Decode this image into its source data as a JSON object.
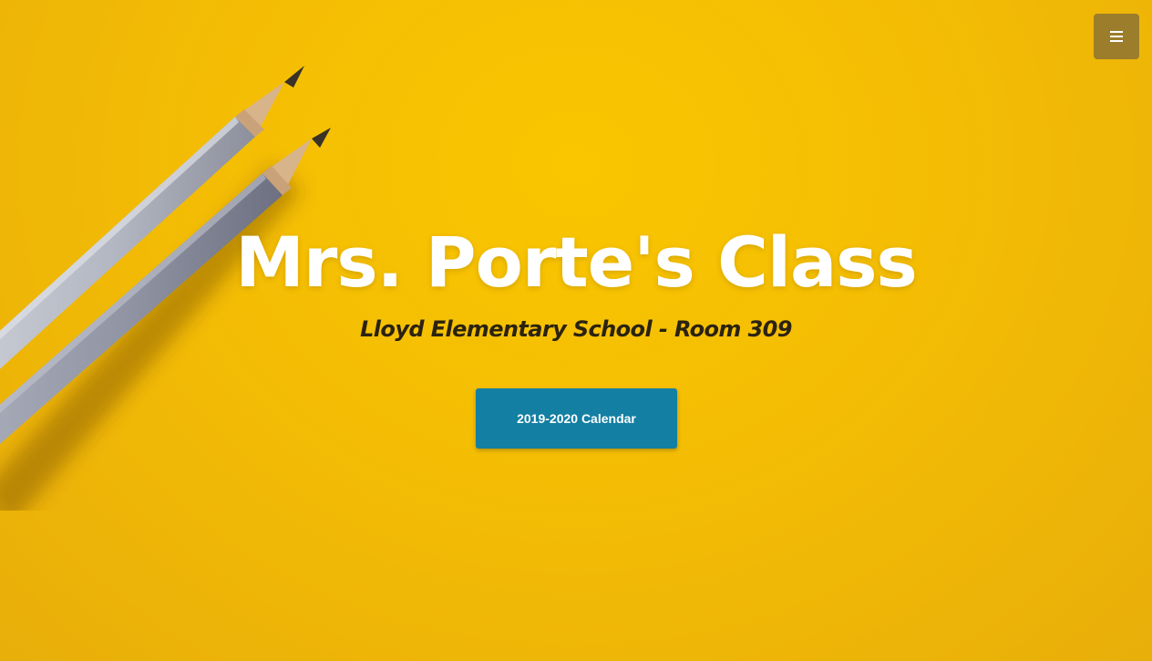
{
  "header": {
    "menu_icon": "hamburger-menu-icon"
  },
  "hero": {
    "title": "Mrs. Porte's Class",
    "subtitle": "Lloyd Elementary School - Room 309",
    "calendar_button_label": "2019-2020 Calendar",
    "background_image": "two-pencils-on-yellow-background"
  },
  "colors": {
    "background": "#f4bd04",
    "menu_button": "#9b7d2b",
    "calendar_button": "#137fa3",
    "title_text": "#ffffff",
    "subtitle_text": "#2b2310"
  }
}
